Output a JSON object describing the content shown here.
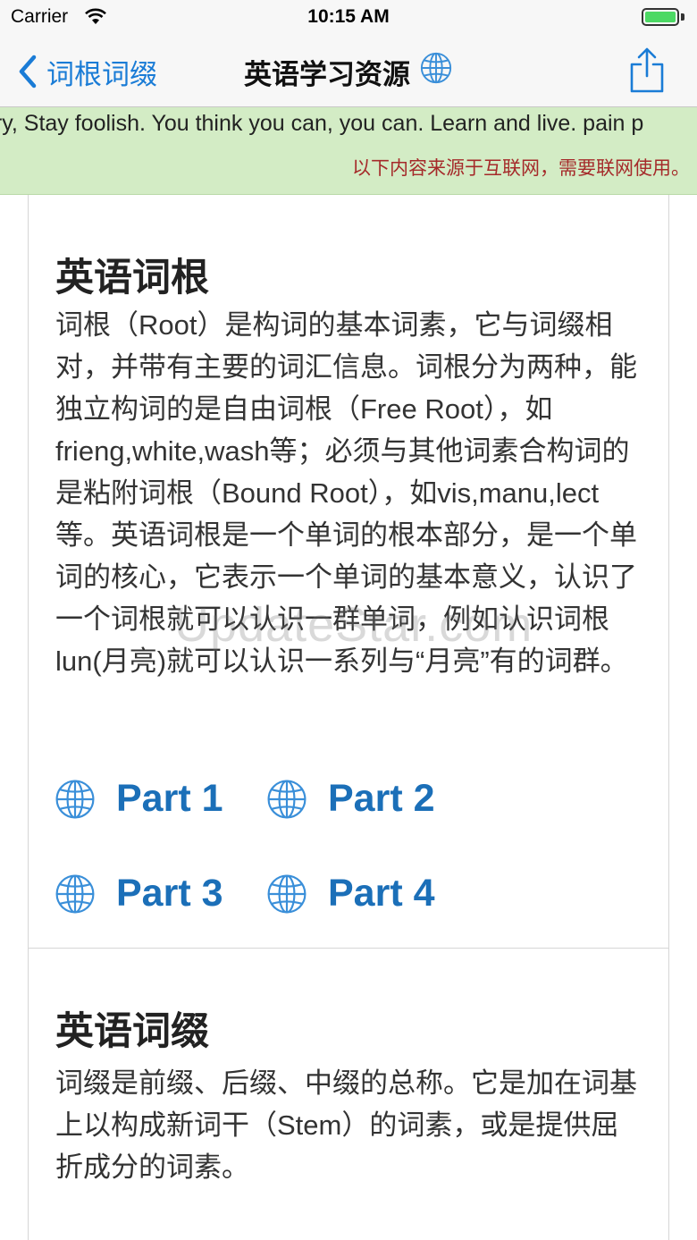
{
  "status_bar": {
    "carrier": "Carrier",
    "time": "10:15 AM",
    "battery_level": 1.0
  },
  "nav": {
    "back_label": "词根词缀",
    "title": "英语学习资源",
    "title_icon": "globe-icon",
    "share_icon": "share-icon"
  },
  "banner": {
    "marquee": "gry, Stay foolish. You think you can, you can. Learn and live. pain p",
    "notice": "以下内容来源于互联网，需要联网使用。"
  },
  "sections": [
    {
      "title": "英语词根",
      "body": "词根（Root）是构词的基本词素，它与词缀相对，并带有主要的词汇信息。词根分为两种，能独立构词的是自由词根（Free Root），如frieng,white,wash等；必须与其他词素合构词的是粘附词根（Bound Root），如vis,manu,lect等。英语词根是一个单词的根本部分，是一个单词的核心，它表示一个单词的基本意义，认识了一个词根就可以认识一群单词，例如认识词根lun(月亮)就可以认识一系列与“月亮”有的词群。",
      "links": [
        "Part 1",
        "Part 2",
        "Part 3",
        "Part 4"
      ]
    },
    {
      "title": "英语词缀",
      "body": "词缀是前缀、后缀、中缀的总称。它是加在词基上以构成新词干（Stem）的词素，或是提供屈折成分的词素。"
    }
  ],
  "watermark": "UpdateStar.com",
  "colors": {
    "accent": "#1a7cd6",
    "link": "#1b6fb8",
    "banner_bg": "#d3ecc5",
    "notice": "#a52a2a",
    "battery": "#4cd964"
  }
}
